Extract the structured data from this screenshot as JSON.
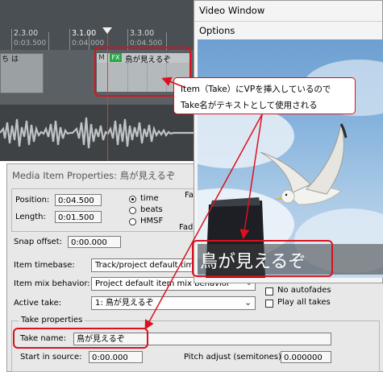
{
  "timeline": {
    "ruler_marks": [
      {
        "bar": "2.3.00",
        "time": "0:03.500"
      },
      {
        "bar": "3.1.00",
        "time": "0:04.000"
      },
      {
        "bar": "3.3.00",
        "time": "0:04.500"
      }
    ],
    "left_item_label": "ち は",
    "right_item": {
      "m_badge": "M",
      "fx_badge": "FX",
      "take_label": "鳥が見えるぞ"
    }
  },
  "video_window": {
    "title": "Video Window",
    "options_menu": "Options",
    "overlay_text": "鳥が見えるぞ"
  },
  "callout": {
    "line1": "Item（Take）にVPを挿入しているので",
    "line2": "Take名がテキストとして使用される"
  },
  "dialog": {
    "title": "Media Item Properties:  鳥が見えるぞ",
    "position_label": "Position:",
    "position_value": "0:04.500",
    "length_label": "Length:",
    "length_value": "0:01.500",
    "time_modes": [
      "time",
      "beats",
      "HMSF"
    ],
    "selected_time_mode": "time",
    "fade_in_label": "Fa",
    "fade_out_label": "Fad",
    "snap_offset_label": "Snap offset:",
    "snap_offset_value": "0:00.000",
    "item_timebase_label": "Item timebase:",
    "item_timebase_value": "Track/project default time",
    "item_mix_label": "Item mix behavior:",
    "item_mix_value": "Project default item mix behavior",
    "active_take_label": "Active take:",
    "active_take_value": "1: 鳥が見えるぞ",
    "no_autofades_label": "No autofades",
    "play_all_takes_label": "Play all takes",
    "take_properties_label": "Take properties",
    "take_name_label": "Take name:",
    "take_name_value": "鳥が見えるぞ",
    "start_in_source_label": "Start in source:",
    "start_in_source_value": "0:00.000",
    "pitch_adjust_label": "Pitch adjust (semitones):",
    "pitch_adjust_value": "0.000000"
  }
}
